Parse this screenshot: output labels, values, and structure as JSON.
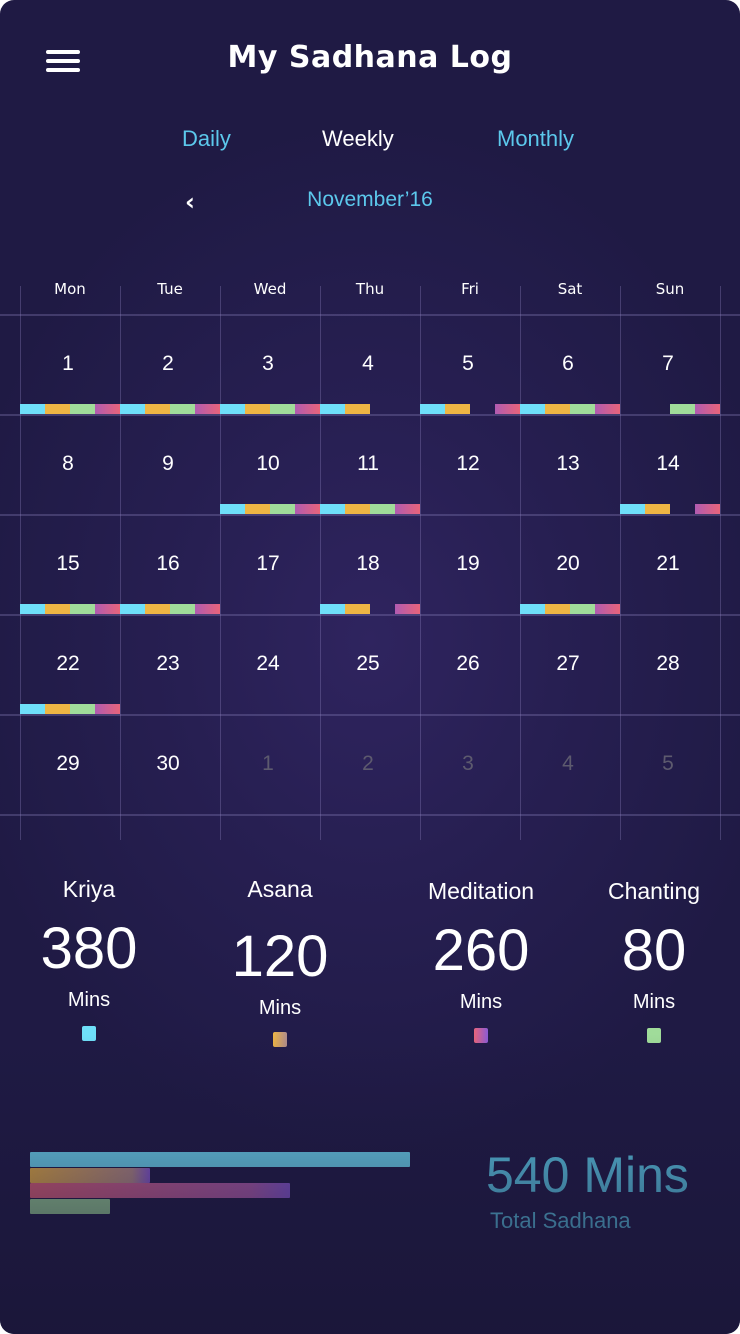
{
  "header": {
    "title": "My Sadhana Log",
    "menu_icon": "hamburger-menu-icon"
  },
  "tabs": [
    {
      "label": "Daily",
      "active": false
    },
    {
      "label": "Weekly",
      "active": true
    },
    {
      "label": "Monthly",
      "active": false
    }
  ],
  "month_nav": {
    "prev_icon": "chevron-left-icon",
    "prev_glyph": "‹",
    "label": "November’16"
  },
  "calendar": {
    "weekdays": [
      "Mon",
      "Tue",
      "Wed",
      "Thu",
      "Fri",
      "Sat",
      "Sun"
    ],
    "practice_order": [
      "kriya",
      "asana",
      "chanting",
      "meditation"
    ],
    "weeks": [
      [
        {
          "day": "1",
          "in_month": true,
          "done": [
            1,
            1,
            1,
            1
          ]
        },
        {
          "day": "2",
          "in_month": true,
          "done": [
            1,
            1,
            1,
            1
          ]
        },
        {
          "day": "3",
          "in_month": true,
          "done": [
            1,
            1,
            1,
            1
          ]
        },
        {
          "day": "4",
          "in_month": true,
          "done": [
            1,
            1,
            0,
            0
          ]
        },
        {
          "day": "5",
          "in_month": true,
          "done": [
            1,
            1,
            0,
            1
          ]
        },
        {
          "day": "6",
          "in_month": true,
          "done": [
            1,
            1,
            1,
            1
          ]
        },
        {
          "day": "7",
          "in_month": true,
          "done": [
            0,
            0,
            1,
            1
          ]
        }
      ],
      [
        {
          "day": "8",
          "in_month": true,
          "done": [
            0,
            0,
            0,
            0
          ]
        },
        {
          "day": "9",
          "in_month": true,
          "done": [
            0,
            0,
            0,
            0
          ]
        },
        {
          "day": "10",
          "in_month": true,
          "done": [
            1,
            1,
            1,
            1
          ]
        },
        {
          "day": "11",
          "in_month": true,
          "done": [
            1,
            1,
            1,
            1
          ]
        },
        {
          "day": "12",
          "in_month": true,
          "done": [
            0,
            0,
            0,
            0
          ]
        },
        {
          "day": "13",
          "in_month": true,
          "done": [
            0,
            0,
            0,
            0
          ]
        },
        {
          "day": "14",
          "in_month": true,
          "done": [
            1,
            1,
            0,
            1
          ]
        }
      ],
      [
        {
          "day": "15",
          "in_month": true,
          "done": [
            1,
            1,
            1,
            1
          ]
        },
        {
          "day": "16",
          "in_month": true,
          "done": [
            1,
            1,
            1,
            1
          ]
        },
        {
          "day": "17",
          "in_month": true,
          "done": [
            0,
            0,
            0,
            0
          ]
        },
        {
          "day": "18",
          "in_month": true,
          "done": [
            1,
            1,
            0,
            1
          ]
        },
        {
          "day": "19",
          "in_month": true,
          "done": [
            0,
            0,
            0,
            0
          ]
        },
        {
          "day": "20",
          "in_month": true,
          "done": [
            1,
            1,
            1,
            1
          ]
        },
        {
          "day": "21",
          "in_month": true,
          "done": [
            0,
            0,
            0,
            0
          ]
        }
      ],
      [
        {
          "day": "22",
          "in_month": true,
          "done": [
            1,
            1,
            1,
            1
          ]
        },
        {
          "day": "23",
          "in_month": true,
          "done": [
            0,
            0,
            0,
            0
          ]
        },
        {
          "day": "24",
          "in_month": true,
          "done": [
            0,
            0,
            0,
            0
          ]
        },
        {
          "day": "25",
          "in_month": true,
          "done": [
            0,
            0,
            0,
            0
          ]
        },
        {
          "day": "26",
          "in_month": true,
          "done": [
            0,
            0,
            0,
            0
          ]
        },
        {
          "day": "27",
          "in_month": true,
          "done": [
            0,
            0,
            0,
            0
          ]
        },
        {
          "day": "28",
          "in_month": true,
          "done": [
            0,
            0,
            0,
            0
          ]
        }
      ],
      [
        {
          "day": "29",
          "in_month": true,
          "done": [
            0,
            0,
            0,
            0
          ]
        },
        {
          "day": "30",
          "in_month": true,
          "done": [
            0,
            0,
            0,
            0
          ]
        },
        {
          "day": "1",
          "in_month": false,
          "done": [
            0,
            0,
            0,
            0
          ]
        },
        {
          "day": "2",
          "in_month": false,
          "done": [
            0,
            0,
            0,
            0
          ]
        },
        {
          "day": "3",
          "in_month": false,
          "done": [
            0,
            0,
            0,
            0
          ]
        },
        {
          "day": "4",
          "in_month": false,
          "done": [
            0,
            0,
            0,
            0
          ]
        },
        {
          "day": "5",
          "in_month": false,
          "done": [
            0,
            0,
            0,
            0
          ]
        }
      ]
    ]
  },
  "stats": [
    {
      "key": "kriya",
      "label": "Kriya",
      "value": "380",
      "unit": "Mins",
      "minutes": 380,
      "color": "#6fdff9"
    },
    {
      "key": "asana",
      "label": "Asana",
      "value": "120",
      "unit": "Mins",
      "minutes": 120,
      "color": "#eeb544",
      "color_end": "#b08c8c"
    },
    {
      "key": "meditation",
      "label": "Meditation",
      "value": "260",
      "unit": "Mins",
      "minutes": 260,
      "color": "#e8647a",
      "color_end": "#8b5bd6"
    },
    {
      "key": "chanting",
      "label": "Chanting",
      "value": "80",
      "unit": "Mins",
      "minutes": 80,
      "color": "#a0dc9a"
    }
  ],
  "total": {
    "value": "540 Mins",
    "label": "Total Sadhana"
  }
}
